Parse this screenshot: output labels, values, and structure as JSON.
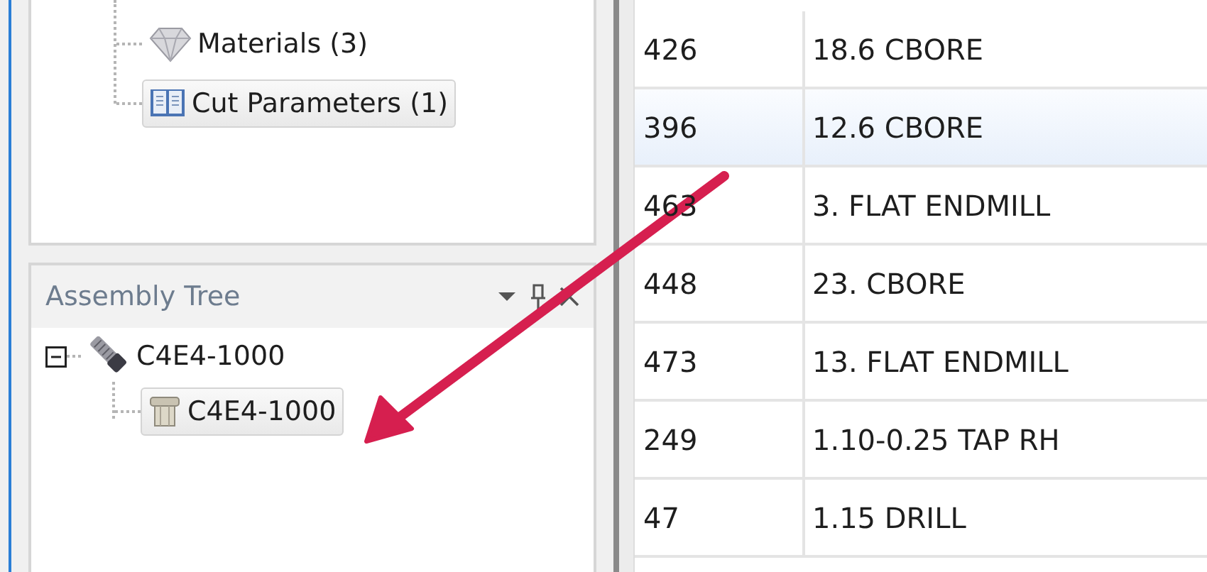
{
  "library_tree": {
    "items": [
      {
        "label": "Materials (3)",
        "kind": "diamond",
        "selected": false
      },
      {
        "label": "Cut Parameters (1)",
        "kind": "book",
        "selected": true
      }
    ]
  },
  "assembly_tree": {
    "title": "Assembly Tree",
    "items": [
      {
        "label": "C4E4-1000",
        "kind": "cutter",
        "selected": false,
        "expanded": true,
        "children": [
          {
            "label": "C4E4-1000",
            "kind": "holder",
            "selected": true
          }
        ]
      }
    ]
  },
  "table": {
    "rows": [
      {
        "cells": [
          "426",
          "18.6 CBORE"
        ],
        "selected": false
      },
      {
        "cells": [
          "396",
          "12.6 CBORE"
        ],
        "selected": true
      },
      {
        "cells": [
          "463",
          "3. FLAT ENDMILL"
        ],
        "selected": false
      },
      {
        "cells": [
          "448",
          "23. CBORE"
        ],
        "selected": false
      },
      {
        "cells": [
          "473",
          "13. FLAT ENDMILL"
        ],
        "selected": false
      },
      {
        "cells": [
          "249",
          "1.10-0.25 TAP RH"
        ],
        "selected": false
      },
      {
        "cells": [
          "47",
          "1.15 DRILL"
        ],
        "selected": false
      }
    ]
  }
}
